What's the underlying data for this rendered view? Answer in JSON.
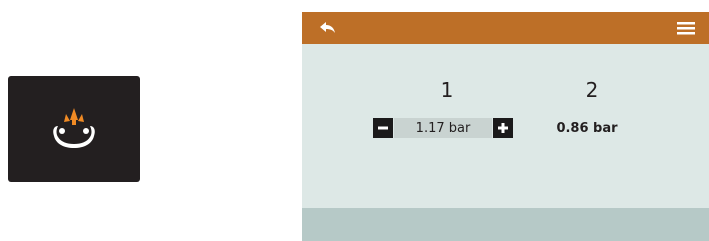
{
  "colors": {
    "header_bar": "#bd6f27",
    "panel_background": "#dde8e6",
    "footer_band": "#b6c9c7",
    "app_icon_background": "#231f20",
    "icon_accent": "#f08a24",
    "stepper_button": "#1b1a1b",
    "editable_field": "#c9d3d1"
  },
  "app_icon": {
    "icon": "tire-pressure-icon"
  },
  "header": {
    "back_icon": "back-arrow-icon",
    "menu_icon": "hamburger-menu-icon"
  },
  "zones": [
    {
      "number": "1",
      "pressure": "1.17 bar",
      "editable": true,
      "decrement_icon": "minus-icon",
      "increment_icon": "plus-icon"
    },
    {
      "number": "2",
      "pressure": "0.86 bar",
      "editable": false
    }
  ]
}
